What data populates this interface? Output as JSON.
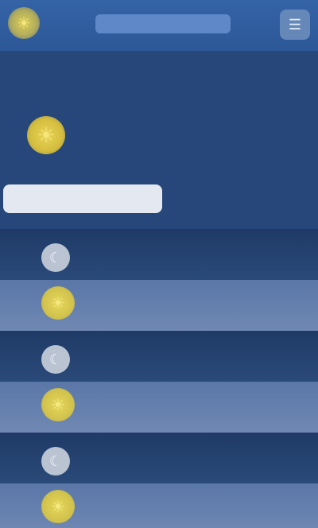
{
  "header": {
    "app_title": "",
    "logo_icon": "sun-icon",
    "menu_icon": "menu-icon"
  },
  "today": {
    "location": "",
    "date": "",
    "condition": "",
    "temperature": "",
    "detail": "",
    "tabs": [
      {
        "label": "",
        "active": true
      },
      {
        "label": "",
        "active": false
      }
    ]
  },
  "forecast": [
    {
      "night": {
        "label": "",
        "temp": "",
        "icon": "moon-icon"
      },
      "day": {
        "label": "",
        "temp": "",
        "icon": "sun-icon"
      }
    },
    {
      "night": {
        "label": "",
        "temp": "",
        "icon": "moon-icon"
      },
      "day": {
        "label": "",
        "temp": "",
        "icon": "sun-icon"
      }
    },
    {
      "night": {
        "label": "",
        "temp": "",
        "icon": "moon-icon"
      },
      "day": {
        "label": "",
        "temp": "",
        "icon": "sun-icon"
      }
    }
  ],
  "colors": {
    "topbar": "#3463a6",
    "background": "#233f6c",
    "sun": "#e6d75a",
    "day_row": "#7088b3"
  }
}
